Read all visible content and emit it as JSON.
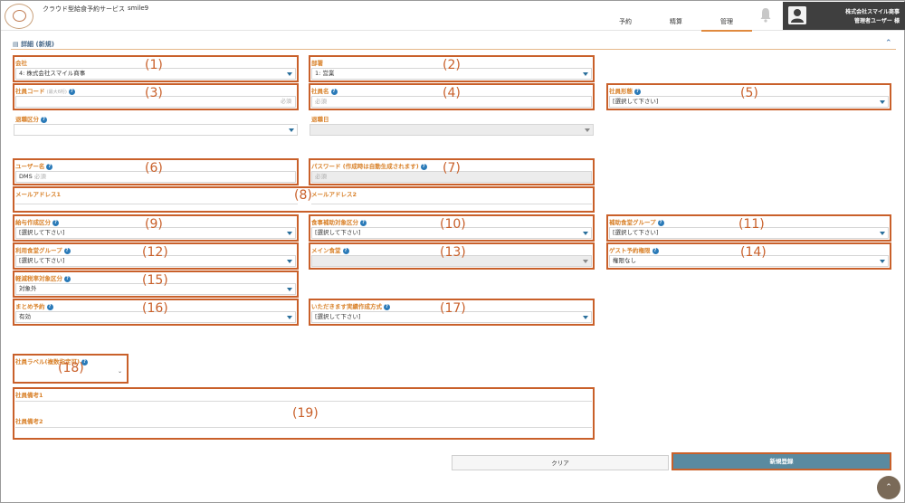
{
  "header": {
    "app_title": "クラウド型給食予約サービス",
    "app_user": "smile9",
    "nav": [
      "予約",
      "精算",
      "管理"
    ],
    "company": "株式会社スマイル商事",
    "role": "管理者ユーザー 様"
  },
  "section": {
    "title": "詳細 (新規)"
  },
  "fields": {
    "company": {
      "label": "会社",
      "value": "4: 株式会社スマイル商事"
    },
    "department": {
      "label": "部署",
      "value": "1: 営業"
    },
    "employee_code": {
      "label": "社員コード",
      "sub": "(最大6桁)",
      "required": "必須"
    },
    "employee_name": {
      "label": "社員名",
      "placeholder": "必須"
    },
    "employee_type": {
      "label": "社員形態",
      "value": "[選択して下さい]"
    },
    "retire_type": {
      "label": "退職区分",
      "value": ""
    },
    "retire_date": {
      "label": "退職日",
      "value": ""
    },
    "user_name": {
      "label": "ユーザー名",
      "value": "DMS",
      "required": "必須"
    },
    "password": {
      "label": "パスワード (作成時は自動生成されます)",
      "placeholder": "必須"
    },
    "email1": {
      "label": "メールアドレス1"
    },
    "email2": {
      "label": "メールアドレス2"
    },
    "salary_type": {
      "label": "給与作成区分",
      "value": "[選択して下さい]"
    },
    "meal_subsidy": {
      "label": "食事補助対象区分",
      "value": "[選択して下さい]"
    },
    "subsidy_group": {
      "label": "補助食堂グループ",
      "value": "[選択して下さい]"
    },
    "cafeteria_group": {
      "label": "利用食堂グループ",
      "value": "[選択して下さい]"
    },
    "main_cafeteria": {
      "label": "メイン食堂",
      "value": ""
    },
    "guest_permission": {
      "label": "ゲスト予約権限",
      "value": "権限なし"
    },
    "reduced_tax": {
      "label": "軽減税率対象区分",
      "value": "対象外"
    },
    "bulk_reserve": {
      "label": "まとめ予約",
      "value": "有効"
    },
    "itadakimasu": {
      "label": "いただきます実績作成方式",
      "value": "[選択して下さい]"
    },
    "employee_label": {
      "label": "社員ラベル(複数指定可)"
    },
    "note1": {
      "label": "社員備考1"
    },
    "note2": {
      "label": "社員備考2"
    }
  },
  "annotations": [
    "(1)",
    "(2)",
    "(3)",
    "(4)",
    "(5)",
    "(6)",
    "(7)",
    "(8)",
    "(9)",
    "(10)",
    "(11)",
    "(12)",
    "(13)",
    "(14)",
    "(15)",
    "(16)",
    "(17)",
    "(18)",
    "(19)"
  ],
  "buttons": {
    "clear": "クリア",
    "save": "新規登録"
  },
  "colors": {
    "accent": "#d9822b",
    "annotation": "#c9602a",
    "primary_button": "#5a8aa0",
    "header_dark": "#3f3f3f"
  }
}
